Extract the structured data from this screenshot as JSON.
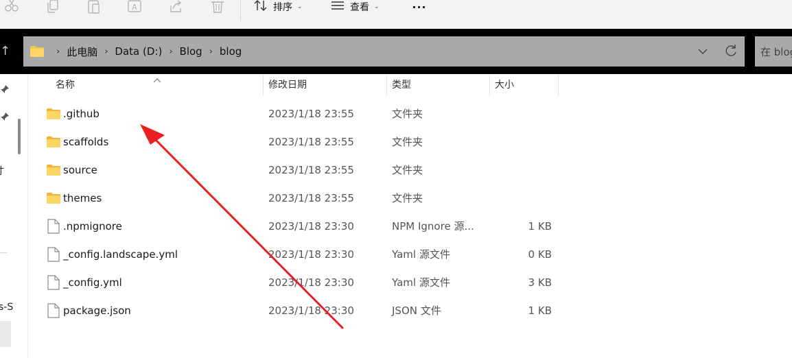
{
  "toolbar": {
    "icons": [
      "cut-icon",
      "copy-icon",
      "paste-icon",
      "rename-icon",
      "share-icon",
      "delete-icon"
    ],
    "sort_label": "排序",
    "view_label": "查看",
    "more_label": "···"
  },
  "address": {
    "crumbs": [
      "此电脑",
      "Data (D:)",
      "Blog",
      "blog"
    ],
    "search_placeholder": "在 blog 中搜索"
  },
  "left_pane": {
    "fragment_1": "寸",
    "fragment_2": "s-S"
  },
  "columns": {
    "name": "名称",
    "date": "修改日期",
    "type": "类型",
    "size": "大小"
  },
  "files": [
    {
      "name": ".github",
      "date": "2023/1/18 23:55",
      "type": "文件夹",
      "size": "",
      "kind": "folder"
    },
    {
      "name": "scaffolds",
      "date": "2023/1/18 23:55",
      "type": "文件夹",
      "size": "",
      "kind": "folder"
    },
    {
      "name": "source",
      "date": "2023/1/18 23:55",
      "type": "文件夹",
      "size": "",
      "kind": "folder"
    },
    {
      "name": "themes",
      "date": "2023/1/18 23:55",
      "type": "文件夹",
      "size": "",
      "kind": "folder"
    },
    {
      "name": ".npmignore",
      "date": "2023/1/18 23:30",
      "type": "NPM Ignore 源...",
      "size": "1 KB",
      "kind": "file"
    },
    {
      "name": "_config.landscape.yml",
      "date": "2023/1/18 23:30",
      "type": "Yaml 源文件",
      "size": "0 KB",
      "kind": "file"
    },
    {
      "name": "_config.yml",
      "date": "2023/1/18 23:30",
      "type": "Yaml 源文件",
      "size": "3 KB",
      "kind": "file"
    },
    {
      "name": "package.json",
      "date": "2023/1/18 23:30",
      "type": "JSON 文件",
      "size": "1 KB",
      "kind": "file"
    }
  ],
  "colors": {
    "folder": "#f8c74a",
    "annotation_arrow": "#e8201f",
    "nav_background": "#000000",
    "address_background": "#a9a9a9"
  }
}
